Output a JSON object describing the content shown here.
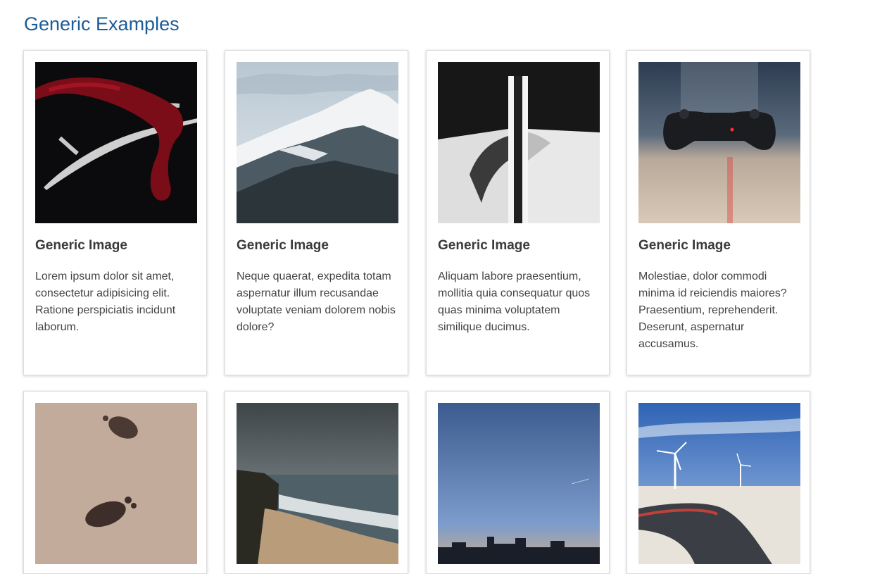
{
  "page": {
    "title": "Generic Examples"
  },
  "cards": [
    {
      "image": "antler-red-scarf-image",
      "title": "Generic Image",
      "text": "Lorem ipsum dolor sit amet, consectetur adipisicing elit. Ratione perspiciatis incidunt laborum."
    },
    {
      "image": "snowy-mountain-image",
      "title": "Generic Image",
      "text": "Neque quaerat, expedita totam aspernatur illum recusandae voluptate veniam dolorem nobis dolore?"
    },
    {
      "image": "architecture-image",
      "title": "Generic Image",
      "text": "Aliquam labore praesentium, mollitia quia consequatur quos quas minima voluptatem similique ducimus."
    },
    {
      "image": "game-controller-image",
      "title": "Generic Image",
      "text": "Molestiae, dolor commodi minima id reiciendis maiores? Praesentium, reprehenderit. Deserunt, aspernatur accusamus."
    },
    {
      "image": "footprints-sand-image",
      "title": "",
      "text": ""
    },
    {
      "image": "coastal-beach-image",
      "title": "",
      "text": ""
    },
    {
      "image": "city-skyline-dusk-image",
      "title": "",
      "text": ""
    },
    {
      "image": "wind-turbines-road-image",
      "title": "",
      "text": ""
    }
  ]
}
